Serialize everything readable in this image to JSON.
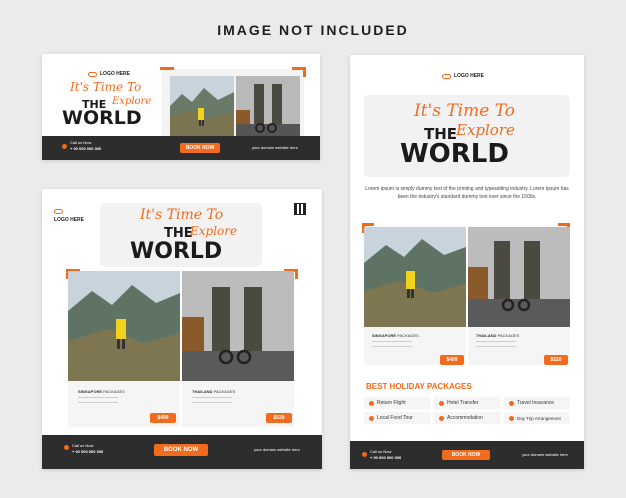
{
  "header": "IMAGE NOT INCLUDED",
  "logo_text": "LOGO HERE",
  "headline": {
    "line1": "It's Time To",
    "the": "THE",
    "explore": "Explore",
    "world": "WORLD"
  },
  "description": "Lorem ipsum is simply dummy text of the printing and typesetting industry. Lorem Ipsum has been the industry's standard dummy text ever since the 1500s.",
  "cta": {
    "call_label": "Call us Now",
    "phone": "+ 00 000 000 000",
    "website": "your domain website here",
    "book": "BOOK NOW"
  },
  "packages": [
    {
      "name": "SINGAPORE",
      "suffix": "PACKAGES",
      "price": "$499"
    },
    {
      "name": "THAILAND",
      "suffix": "PACKAGES",
      "price": "$520"
    }
  ],
  "holiday_title": "BEST HOLIDAY PACKAGES",
  "features": [
    "Return Flight",
    "Hotel Transfer",
    "Travel Insurance",
    "Local Food Tour",
    "Accommodation",
    "Day Trip Arrangement"
  ],
  "colors": {
    "accent": "#f26a1b",
    "dark": "#2d2d2d",
    "bg": "#ebebeb"
  }
}
